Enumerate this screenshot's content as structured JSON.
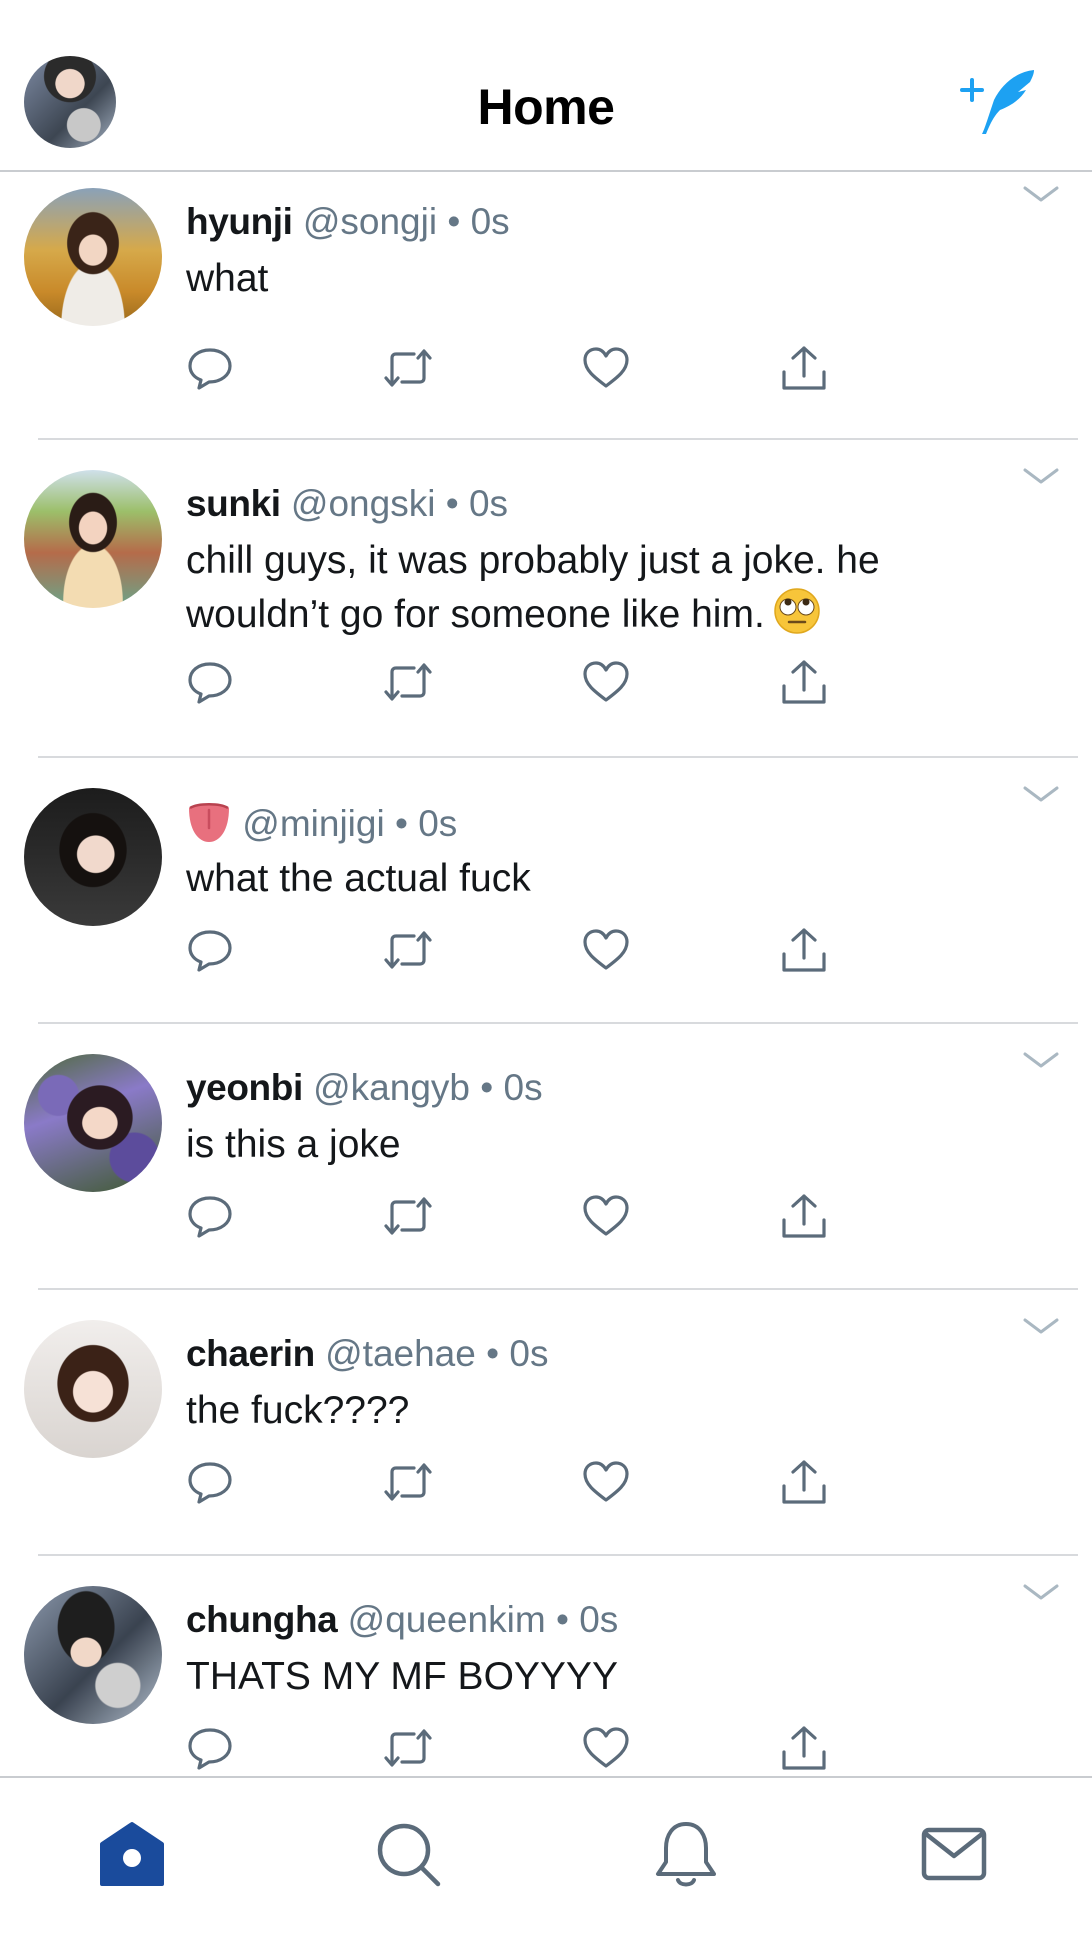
{
  "header": {
    "title": "Home",
    "avatar_icon": "profile-avatar",
    "compose_icon": "compose-tweet-icon"
  },
  "colors": {
    "accent": "#1da1f2",
    "nav_active": "#1a4b9c",
    "text_secondary": "#657786",
    "icon_gray": "#5b6b7a"
  },
  "tweets": [
    {
      "name": "hyunji",
      "handle": "@songji",
      "dot": "•",
      "time": "0s",
      "text": "what"
    },
    {
      "name": "sunki",
      "handle": "@ongski",
      "dot": "•",
      "time": "0s",
      "text_line1": "chill guys, it was probably just a joke. he",
      "text_line2": "wouldn’t go for someone like him.",
      "emoji": "🙄"
    },
    {
      "name_emoji": "👅",
      "handle": "@minjigi",
      "dot": "•",
      "time": "0s",
      "text": "what the actual fuck"
    },
    {
      "name": "yeonbi",
      "handle": "@kangyb",
      "dot": "•",
      "time": "0s",
      "text": "is this a joke"
    },
    {
      "name": "chaerin",
      "handle": "@taehae",
      "dot": "•",
      "time": "0s",
      "text": "the fuck????"
    },
    {
      "name": "chungha",
      "handle": "@queenkim",
      "dot": "•",
      "time": "0s",
      "text": "THATS MY MF BOYYYY"
    }
  ],
  "tweet_actions": [
    "reply-icon",
    "retweet-icon",
    "like-icon",
    "share-icon"
  ],
  "nav": [
    "home-icon",
    "search-icon",
    "notifications-icon",
    "messages-icon"
  ]
}
